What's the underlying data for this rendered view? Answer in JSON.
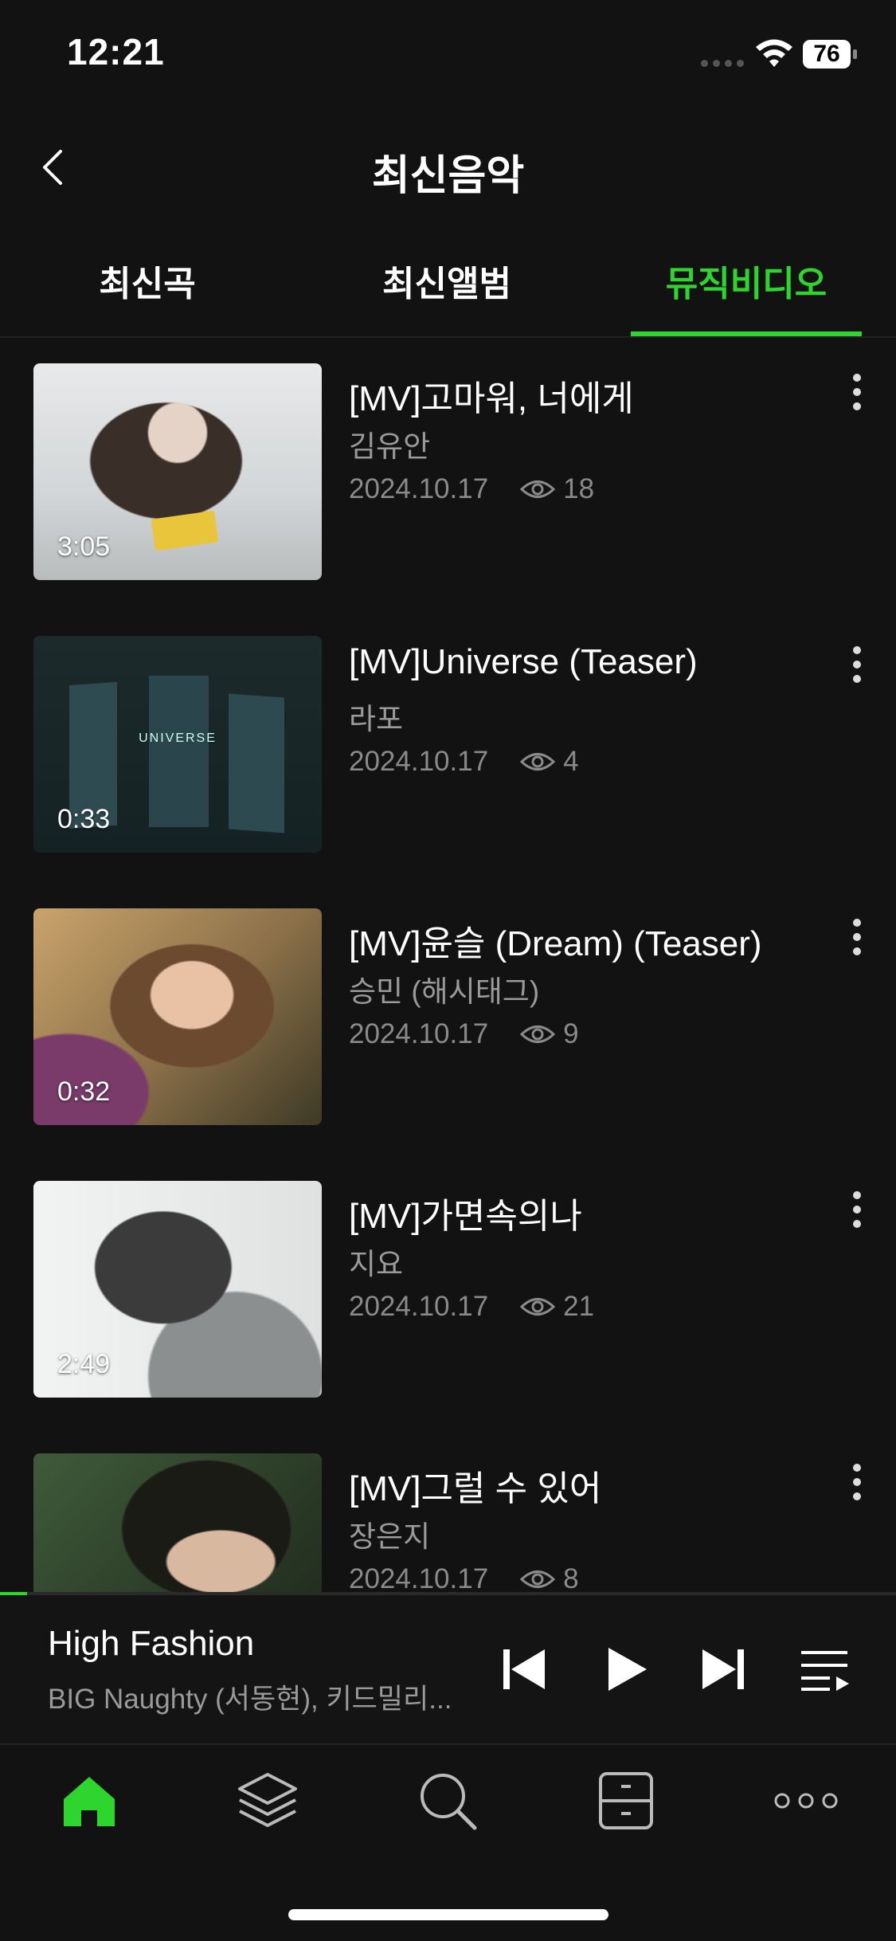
{
  "status": {
    "time": "12:21",
    "battery": "76"
  },
  "header": {
    "title": "최신음악"
  },
  "tabs": [
    {
      "label": "최신곡"
    },
    {
      "label": "최신앨범"
    },
    {
      "label": "뮤직비디오"
    }
  ],
  "active_tab": "뮤직비디오",
  "videos": [
    {
      "title": "[MV]고마워, 너에게",
      "artist": "김유안",
      "date": "2024.10.17",
      "views": "18",
      "duration": "3:05"
    },
    {
      "title": "[MV]Universe (Teaser)",
      "artist": "라포",
      "date": "2024.10.17",
      "views": "4",
      "duration": "0:33",
      "thumb_text": "UNIVERSE"
    },
    {
      "title": "[MV]윤슬 (Dream) (Teaser)",
      "artist": "승민 (해시태그)",
      "date": "2024.10.17",
      "views": "9",
      "duration": "0:32"
    },
    {
      "title": "[MV]가면속의나",
      "artist": "지요",
      "date": "2024.10.17",
      "views": "21",
      "duration": "2:49"
    },
    {
      "title": "[MV]그럴 수 있어",
      "artist": "장은지",
      "date": "2024.10.17",
      "views": "8",
      "duration": ""
    }
  ],
  "player": {
    "title": "High Fashion",
    "artist": "BIG Naughty (서동현), 키드밀리...",
    "progress": 0.03
  },
  "nav": {
    "items": [
      "home-icon",
      "layers-icon",
      "search-icon",
      "library-icon",
      "more-icon"
    ],
    "active": "home-icon"
  },
  "colors": {
    "accent": "#2fd52f",
    "background": "#121212",
    "secondary_text": "#9a9a9a"
  }
}
